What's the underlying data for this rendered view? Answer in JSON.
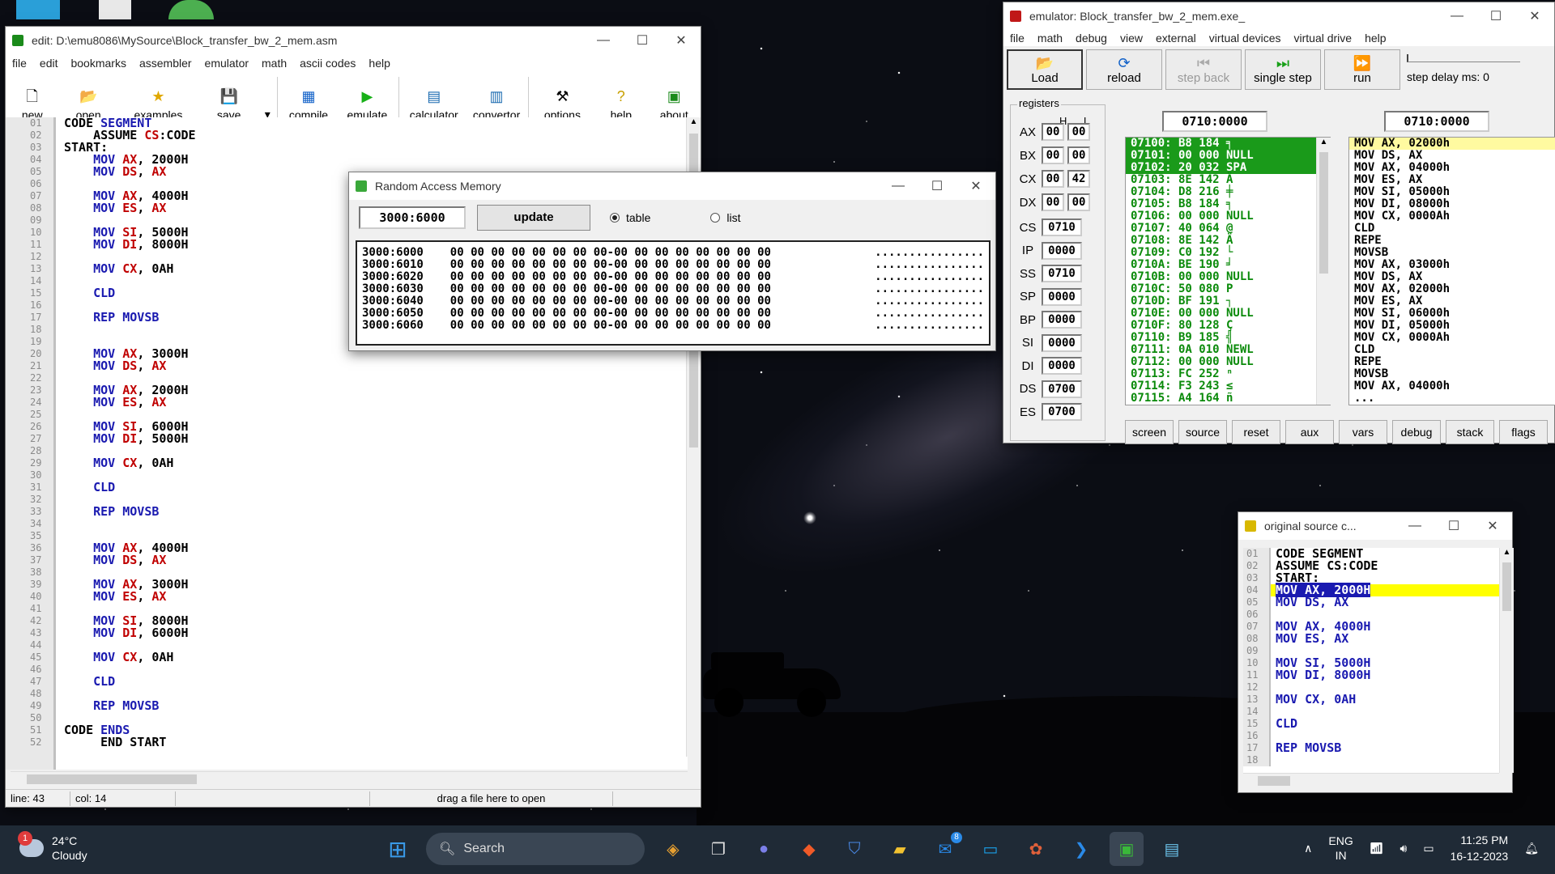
{
  "edit_window": {
    "title": "edit: D:\\emu8086\\MySource\\Block_transfer_bw_2_mem.asm",
    "menu": [
      "file",
      "edit",
      "bookmarks",
      "assembler",
      "emulator",
      "math",
      "ascii codes",
      "help"
    ],
    "toolbar": [
      "new",
      "open",
      "examples",
      "save",
      "compile",
      "emulate",
      "calculator",
      "convertor",
      "options",
      "help",
      "about"
    ],
    "lines": [
      [
        "01",
        [
          [
            "op",
            "CODE "
          ],
          [
            "kw",
            "SEGMENT"
          ]
        ]
      ],
      [
        "02",
        [
          [
            "op",
            "    ASSUME "
          ],
          [
            "reg",
            "CS"
          ],
          [
            "op",
            ":CODE"
          ]
        ]
      ],
      [
        "03",
        [
          [
            "op",
            "START:"
          ]
        ]
      ],
      [
        "04",
        [
          [
            "op",
            "    "
          ],
          [
            "kw",
            "MOV "
          ],
          [
            "reg",
            "AX"
          ],
          [
            "op",
            ", 2000H"
          ]
        ]
      ],
      [
        "05",
        [
          [
            "op",
            "    "
          ],
          [
            "kw",
            "MOV "
          ],
          [
            "reg",
            "DS"
          ],
          [
            "op",
            ", "
          ],
          [
            "reg",
            "AX"
          ]
        ]
      ],
      [
        "06",
        []
      ],
      [
        "07",
        [
          [
            "op",
            "    "
          ],
          [
            "kw",
            "MOV "
          ],
          [
            "reg",
            "AX"
          ],
          [
            "op",
            ", 4000H"
          ]
        ]
      ],
      [
        "08",
        [
          [
            "op",
            "    "
          ],
          [
            "kw",
            "MOV "
          ],
          [
            "reg",
            "ES"
          ],
          [
            "op",
            ", "
          ],
          [
            "reg",
            "AX"
          ]
        ]
      ],
      [
        "09",
        []
      ],
      [
        "10",
        [
          [
            "op",
            "    "
          ],
          [
            "kw",
            "MOV "
          ],
          [
            "reg",
            "SI"
          ],
          [
            "op",
            ", 5000H"
          ]
        ]
      ],
      [
        "11",
        [
          [
            "op",
            "    "
          ],
          [
            "kw",
            "MOV "
          ],
          [
            "reg",
            "DI"
          ],
          [
            "op",
            ", 8000H"
          ]
        ]
      ],
      [
        "12",
        []
      ],
      [
        "13",
        [
          [
            "op",
            "    "
          ],
          [
            "kw",
            "MOV "
          ],
          [
            "reg",
            "CX"
          ],
          [
            "op",
            ", 0AH"
          ]
        ]
      ],
      [
        "14",
        []
      ],
      [
        "15",
        [
          [
            "op",
            "    "
          ],
          [
            "kw",
            "CLD"
          ]
        ]
      ],
      [
        "16",
        []
      ],
      [
        "17",
        [
          [
            "op",
            "    "
          ],
          [
            "kw",
            "REP MOVSB"
          ]
        ]
      ],
      [
        "18",
        []
      ],
      [
        "19",
        []
      ],
      [
        "20",
        [
          [
            "op",
            "    "
          ],
          [
            "kw",
            "MOV "
          ],
          [
            "reg",
            "AX"
          ],
          [
            "op",
            ", 3000H"
          ]
        ]
      ],
      [
        "21",
        [
          [
            "op",
            "    "
          ],
          [
            "kw",
            "MOV "
          ],
          [
            "reg",
            "DS"
          ],
          [
            "op",
            ", "
          ],
          [
            "reg",
            "AX"
          ]
        ]
      ],
      [
        "22",
        []
      ],
      [
        "23",
        [
          [
            "op",
            "    "
          ],
          [
            "kw",
            "MOV "
          ],
          [
            "reg",
            "AX"
          ],
          [
            "op",
            ", 2000H"
          ]
        ]
      ],
      [
        "24",
        [
          [
            "op",
            "    "
          ],
          [
            "kw",
            "MOV "
          ],
          [
            "reg",
            "ES"
          ],
          [
            "op",
            ", "
          ],
          [
            "reg",
            "AX"
          ]
        ]
      ],
      [
        "25",
        []
      ],
      [
        "26",
        [
          [
            "op",
            "    "
          ],
          [
            "kw",
            "MOV "
          ],
          [
            "reg",
            "SI"
          ],
          [
            "op",
            ", 6000H"
          ]
        ]
      ],
      [
        "27",
        [
          [
            "op",
            "    "
          ],
          [
            "kw",
            "MOV "
          ],
          [
            "reg",
            "DI"
          ],
          [
            "op",
            ", 5000H"
          ]
        ]
      ],
      [
        "28",
        []
      ],
      [
        "29",
        [
          [
            "op",
            "    "
          ],
          [
            "kw",
            "MOV "
          ],
          [
            "reg",
            "CX"
          ],
          [
            "op",
            ", 0AH"
          ]
        ]
      ],
      [
        "30",
        []
      ],
      [
        "31",
        [
          [
            "op",
            "    "
          ],
          [
            "kw",
            "CLD"
          ]
        ]
      ],
      [
        "32",
        []
      ],
      [
        "33",
        [
          [
            "op",
            "    "
          ],
          [
            "kw",
            "REP MOVSB"
          ]
        ]
      ],
      [
        "34",
        []
      ],
      [
        "35",
        []
      ],
      [
        "36",
        [
          [
            "op",
            "    "
          ],
          [
            "kw",
            "MOV "
          ],
          [
            "reg",
            "AX"
          ],
          [
            "op",
            ", 4000H"
          ]
        ]
      ],
      [
        "37",
        [
          [
            "op",
            "    "
          ],
          [
            "kw",
            "MOV "
          ],
          [
            "reg",
            "DS"
          ],
          [
            "op",
            ", "
          ],
          [
            "reg",
            "AX"
          ]
        ]
      ],
      [
        "38",
        []
      ],
      [
        "39",
        [
          [
            "op",
            "    "
          ],
          [
            "kw",
            "MOV "
          ],
          [
            "reg",
            "AX"
          ],
          [
            "op",
            ", 3000H"
          ]
        ]
      ],
      [
        "40",
        [
          [
            "op",
            "    "
          ],
          [
            "kw",
            "MOV "
          ],
          [
            "reg",
            "ES"
          ],
          [
            "op",
            ", "
          ],
          [
            "reg",
            "AX"
          ]
        ]
      ],
      [
        "41",
        []
      ],
      [
        "42",
        [
          [
            "op",
            "    "
          ],
          [
            "kw",
            "MOV "
          ],
          [
            "reg",
            "SI"
          ],
          [
            "op",
            ", 8000H"
          ]
        ]
      ],
      [
        "43",
        [
          [
            "op",
            "    "
          ],
          [
            "kw",
            "MOV "
          ],
          [
            "reg",
            "DI"
          ],
          [
            "op",
            ", 6000H"
          ]
        ]
      ],
      [
        "44",
        []
      ],
      [
        "45",
        [
          [
            "op",
            "    "
          ],
          [
            "kw",
            "MOV "
          ],
          [
            "reg",
            "CX"
          ],
          [
            "op",
            ", 0AH"
          ]
        ]
      ],
      [
        "46",
        []
      ],
      [
        "47",
        [
          [
            "op",
            "    "
          ],
          [
            "kw",
            "CLD"
          ]
        ]
      ],
      [
        "48",
        []
      ],
      [
        "49",
        [
          [
            "op",
            "    "
          ],
          [
            "kw",
            "REP MOVSB"
          ]
        ]
      ],
      [
        "50",
        []
      ],
      [
        "51",
        [
          [
            "op",
            "CODE "
          ],
          [
            "kw",
            "ENDS"
          ]
        ]
      ],
      [
        "52",
        [
          [
            "op",
            "     END START"
          ]
        ]
      ]
    ],
    "status": {
      "line": "line: 43",
      "col": "col: 14",
      "hint": "drag a file here to open"
    }
  },
  "ram_window": {
    "title": "Random Access Memory",
    "address": "3000:6000",
    "update_label": "update",
    "radio_table": "table",
    "radio_list": "list",
    "rows": [
      [
        "3000:6000",
        "00 00 00 00 00 00 00 00-00 00 00 00 00 00 00 00",
        "................"
      ],
      [
        "3000:6010",
        "00 00 00 00 00 00 00 00-00 00 00 00 00 00 00 00",
        "................"
      ],
      [
        "3000:6020",
        "00 00 00 00 00 00 00 00-00 00 00 00 00 00 00 00",
        "................"
      ],
      [
        "3000:6030",
        "00 00 00 00 00 00 00 00-00 00 00 00 00 00 00 00",
        "................"
      ],
      [
        "3000:6040",
        "00 00 00 00 00 00 00 00-00 00 00 00 00 00 00 00",
        "................"
      ],
      [
        "3000:6050",
        "00 00 00 00 00 00 00 00-00 00 00 00 00 00 00 00",
        "................"
      ],
      [
        "3000:6060",
        "00 00 00 00 00 00 00 00-00 00 00 00 00 00 00 00",
        "................"
      ]
    ]
  },
  "emu_window": {
    "title": "emulator: Block_transfer_bw_2_mem.exe_",
    "menu": [
      "file",
      "math",
      "debug",
      "view",
      "external",
      "virtual devices",
      "virtual drive",
      "help"
    ],
    "buttons": [
      "Load",
      "reload",
      "step back",
      "single step",
      "run"
    ],
    "step_delay": "step delay ms: 0",
    "registers_label": "registers",
    "h_label": "H",
    "l_label": "L",
    "regs8": [
      [
        "AX",
        "00",
        "00"
      ],
      [
        "BX",
        "00",
        "00"
      ],
      [
        "CX",
        "00",
        "42"
      ],
      [
        "DX",
        "00",
        "00"
      ]
    ],
    "regs16": [
      [
        "CS",
        "0710"
      ],
      [
        "IP",
        "0000"
      ],
      [
        "SS",
        "0710"
      ],
      [
        "SP",
        "0000"
      ],
      [
        "BP",
        "0000"
      ],
      [
        "SI",
        "0000"
      ],
      [
        "DI",
        "0000"
      ],
      [
        "DS",
        "0700"
      ],
      [
        "ES",
        "0700"
      ]
    ],
    "addr_left": "0710:0000",
    "addr_right": "0710:0000",
    "disasm": [
      [
        "07100: B8 184 ╕",
        true
      ],
      [
        "07101: 00 000 NULL",
        true
      ],
      [
        "07102: 20 032 SPA",
        true
      ],
      [
        "07103: 8E 142 Ä",
        false
      ],
      [
        "07104: D8 216 ╪",
        false
      ],
      [
        "07105: B8 184 ╕",
        false
      ],
      [
        "07106: 00 000 NULL",
        false
      ],
      [
        "07107: 40 064 @",
        false
      ],
      [
        "07108: 8E 142 Ä",
        false
      ],
      [
        "07109: C0 192 └",
        false
      ],
      [
        "0710A: BE 190 ╛",
        false
      ],
      [
        "0710B: 00 000 NULL",
        false
      ],
      [
        "0710C: 50 080 P",
        false
      ],
      [
        "0710D: BF 191 ┐",
        false
      ],
      [
        "0710E: 00 000 NULL",
        false
      ],
      [
        "0710F: 80 128 Ç",
        false
      ],
      [
        "07110: B9 185 ╣",
        false
      ],
      [
        "07111: 0A 010 NEWL",
        false
      ],
      [
        "07112: 00 000 NULL",
        false
      ],
      [
        "07113: FC 252 ⁿ",
        false
      ],
      [
        "07114: F3 243 ≤",
        false
      ],
      [
        "07115: A4 164 ñ",
        false
      ]
    ],
    "asm": [
      "MOV AX, 02000h",
      "MOV DS, AX",
      "MOV AX, 04000h",
      "MOV ES, AX",
      "MOV SI, 05000h",
      "MOV DI, 08000h",
      "MOV CX, 0000Ah",
      "CLD",
      "REPE",
      "MOVSB",
      "MOV AX, 03000h",
      "MOV DS, AX",
      "MOV AX, 02000h",
      "MOV ES, AX",
      "MOV SI, 06000h",
      "MOV DI, 05000h",
      "MOV CX, 0000Ah",
      "CLD",
      "REPE",
      "MOVSB",
      "MOV AX, 04000h",
      "..."
    ],
    "bottom": [
      "screen",
      "source",
      "reset",
      "aux",
      "vars",
      "debug",
      "stack",
      "flags"
    ]
  },
  "orig_window": {
    "title": "original source c...",
    "lines": [
      [
        "01",
        "CODE SEGMENT"
      ],
      [
        "02",
        "ASSUME CS:CODE"
      ],
      [
        "03",
        "START:"
      ],
      [
        "04",
        "MOV AX, 2000H"
      ],
      [
        "05",
        "MOV DS, AX"
      ],
      [
        "06",
        ""
      ],
      [
        "07",
        "MOV AX, 4000H"
      ],
      [
        "08",
        "MOV ES, AX"
      ],
      [
        "09",
        ""
      ],
      [
        "10",
        "MOV SI, 5000H"
      ],
      [
        "11",
        "MOV DI, 8000H"
      ],
      [
        "12",
        ""
      ],
      [
        "13",
        "MOV CX, 0AH"
      ],
      [
        "14",
        ""
      ],
      [
        "15",
        "CLD"
      ],
      [
        "16",
        ""
      ],
      [
        "17",
        "REP MOVSB"
      ],
      [
        "18",
        ""
      ]
    ],
    "current": "04"
  },
  "taskbar": {
    "temp": "24°C",
    "weather": "Cloudy",
    "badge": "1",
    "search": "Search",
    "lang1": "ENG",
    "lang2": "IN",
    "time": "11:25 PM",
    "date": "16-12-2023",
    "mail_badge": "8"
  }
}
